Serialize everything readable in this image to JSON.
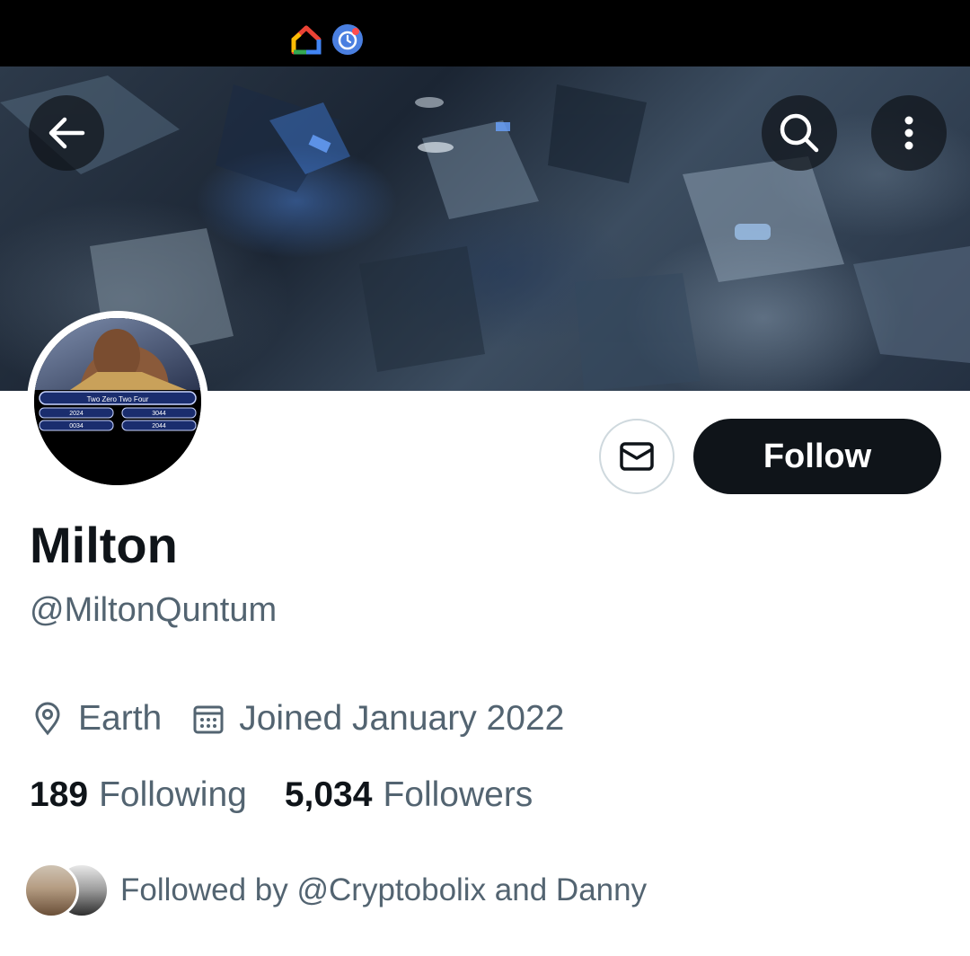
{
  "status_bar": {
    "icons": [
      "google-home-icon",
      "alarm-app-icon"
    ]
  },
  "header": {
    "back_icon": "arrow-left-icon",
    "search_icon": "search-icon",
    "more_icon": "more-vertical-icon"
  },
  "profile": {
    "avatar_caption": "Two Zero Two Four",
    "avatar_answers": [
      "2024",
      "3044",
      "0034",
      "2044"
    ],
    "display_name": "Milton",
    "handle": "@MiltonQuntum",
    "location": "Earth",
    "joined": "Joined January 2022",
    "following_count": "189",
    "following_label": "Following",
    "followers_count": "5,034",
    "followers_label": "Followers",
    "followed_by": "Followed by @Cryptobolix and Danny"
  },
  "actions": {
    "message_icon": "mail-icon",
    "follow_label": "Follow"
  },
  "colors": {
    "text_primary": "#0f1419",
    "text_secondary": "#536471",
    "follow_bg": "#0f1419",
    "border": "#cfd9de"
  }
}
